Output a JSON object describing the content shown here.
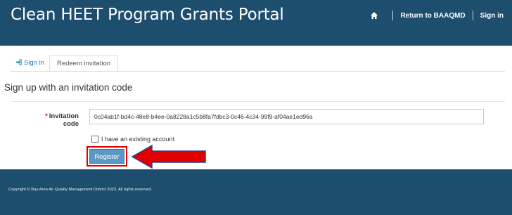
{
  "header": {
    "title": "Clean HEET Program Grants Portal",
    "nav": {
      "home_icon": "home-icon",
      "return_label": "Return to BAAQMD",
      "signin_label": "Sign in"
    },
    "bg_color": "#1e4e6e"
  },
  "tabs": [
    {
      "label": "Sign in",
      "icon": "sign-in-icon"
    },
    {
      "label": "Redeem invitation"
    }
  ],
  "main": {
    "heading": "Sign up with an invitation code",
    "invitation_label": "Invitation code",
    "required_marker": "*",
    "invitation_value": "0c04ab1f-bd4c-48e8-b4ee-0a8228a1c5b8fa7fdbc3-0c46-4c34-99f9-af04ae1ed96a",
    "existing_account_label": "I have an existing account",
    "register_label": "Register"
  },
  "annotation": {
    "highlight_color": "#e00000",
    "arrow_color": "#e00000"
  },
  "footer": {
    "copyright": "Copyright © Bay Area Air Quality Management District 2023. All rights reserved."
  }
}
